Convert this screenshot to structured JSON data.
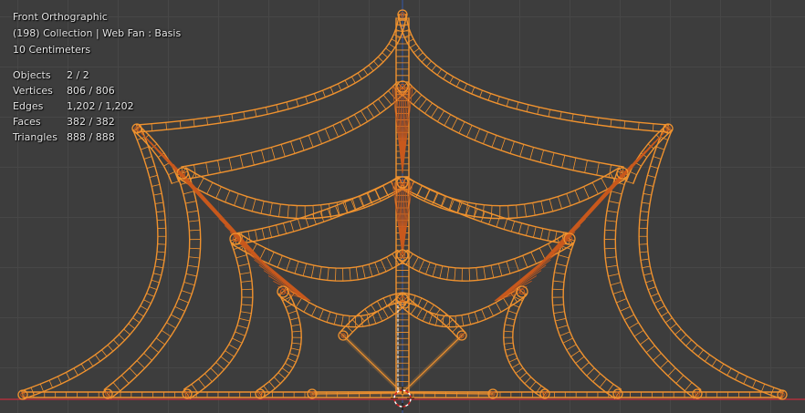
{
  "viewport": {
    "view_name": "Front Orthographic",
    "collection_line": "(198) Collection | Web Fan : Basis",
    "scale": "10 Centimeters",
    "stats": [
      {
        "label": "Objects",
        "value": "2 / 2"
      },
      {
        "label": "Vertices",
        "value": "806 / 806"
      },
      {
        "label": "Edges",
        "value": "1,202 / 1,202"
      },
      {
        "label": "Faces",
        "value": "382 / 382"
      },
      {
        "label": "Triangles",
        "value": "888 / 888"
      }
    ]
  },
  "colors": {
    "background": "#3d3d3d",
    "grid": "#474747",
    "mesh_selected": "#f0922e",
    "mesh_inner": "#c8581c",
    "axis_x": "#b0303c",
    "axis_z": "#3556a8"
  }
}
